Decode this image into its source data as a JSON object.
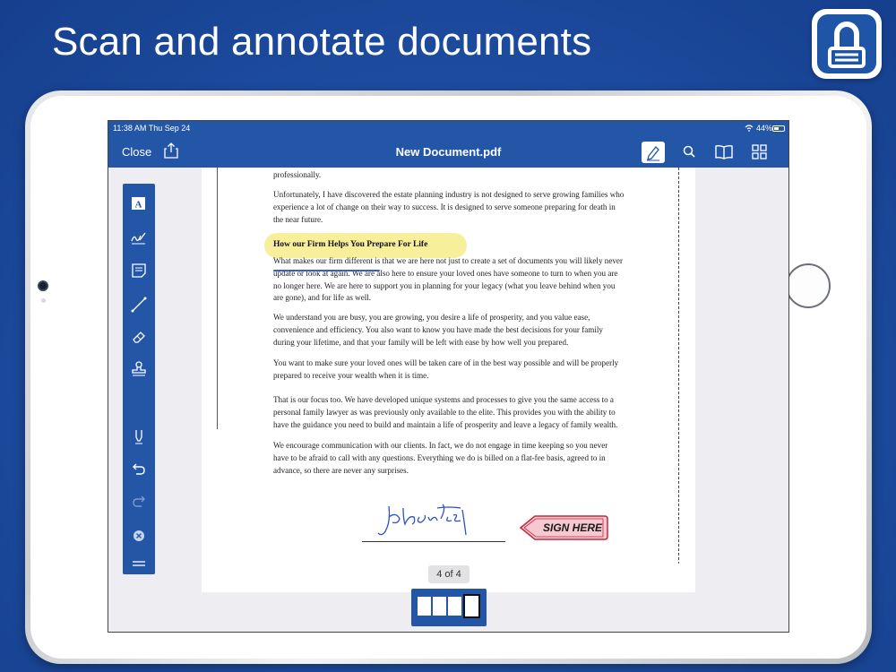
{
  "headline": "Scan and annotate documents",
  "status_bar": {
    "time": "11:38 AM  Thu Sep 24",
    "battery": "44%"
  },
  "toolbar": {
    "close_label": "Close",
    "title": "New Document.pdf",
    "icons": [
      "share-icon",
      "pen-icon",
      "search-icon",
      "book-icon",
      "grid-icon"
    ]
  },
  "annotation_tools": [
    "text-tool-icon",
    "signature-tool-icon",
    "note-tool-icon",
    "line-tool-icon",
    "eraser-tool-icon",
    "stamp-tool-icon",
    "highlighter-icon",
    "undo-icon",
    "redo-icon",
    "clear-icon",
    "menu-icon"
  ],
  "document": {
    "paragraphs": [
      "professionally.",
      "Unfortunately, I have discovered the estate planning industry is not designed to serve growing families who experience a lot of change on their way to success. It is designed to serve someone preparing for death in the near future.",
      "What makes our firm different is that we are here not just to create a set of documents you will likely never update or look at again. We are also here to ensure your loved ones have someone to turn to when you are no longer here.  We are here to support you in planning for your legacy (what you leave behind when you are gone), and for life as well.",
      "We understand you are busy, you are growing, you desire a life of prosperity, and you value ease, convenience and efficiency. You also want to know you have made the best decisions for your family during your lifetime, and that your family will be left with ease by how well you prepared.",
      "You want to make sure your loved ones will be taken care of in the best way possible and will be properly prepared to receive your wealth when it is time.",
      "That is our focus too. We have developed unique systems and processes to give you the same access to a personal family lawyer as was previously only available to the elite. This provides you with the ability to have the guidance you need to build and maintain a life of prosperity and leave a legacy of family wealth.",
      "We encourage communication with our clients. In fact, we do not engage in time keeping so you never have to be afraid to call with any questions. Everything we do is billed on a flat-fee basis, agreed to in advance, so there are never any surprises."
    ],
    "heading": "How our Firm Helps You Prepare For Life",
    "signature": "Johann Test",
    "sign_here": "SIGN HERE"
  },
  "page_indicator": "4 of 4",
  "colors": {
    "background": "#1f4fa3",
    "toolbar": "#2356a7",
    "highlight": "#f8ef9a",
    "ink": "#3a5fc4",
    "sign_here_fill": "#f6c9d0"
  }
}
